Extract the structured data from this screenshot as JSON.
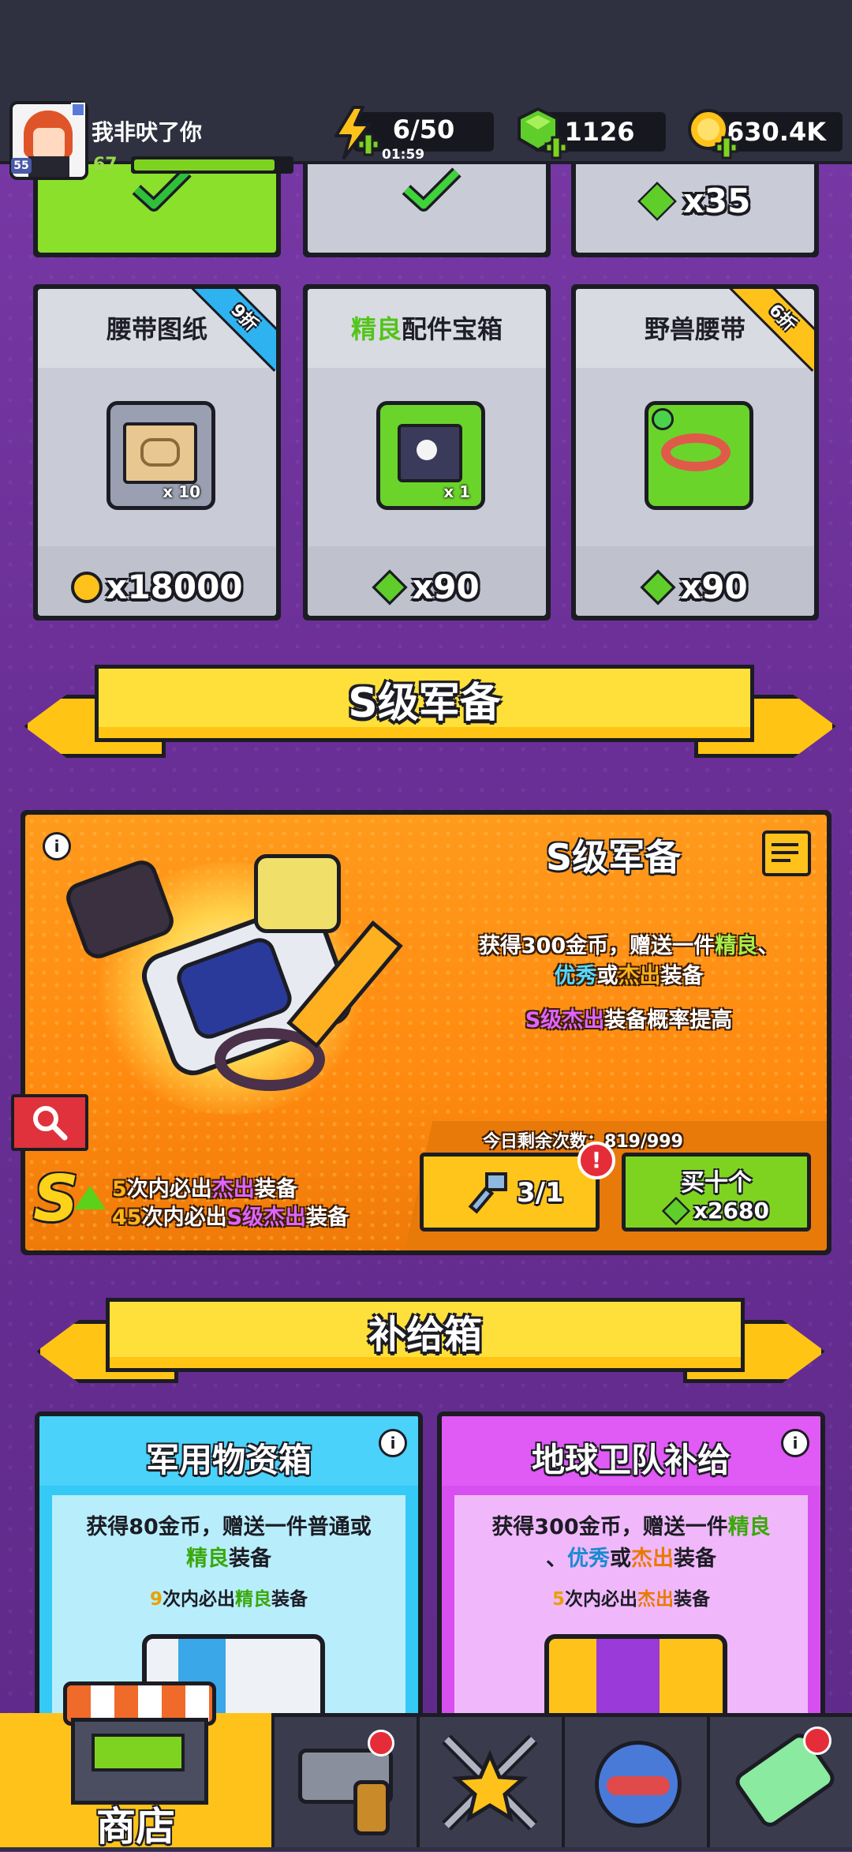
{
  "player": {
    "name": "我非吠了你",
    "level": "55",
    "xp_level": "67",
    "xp_progress": 0.9
  },
  "resources": {
    "energy": {
      "value": "6/50",
      "timer": "01:59"
    },
    "gems": {
      "value": "1126"
    },
    "coins": {
      "value": "630.4K"
    }
  },
  "top_row": {
    "gem_price": "x35"
  },
  "shop_cards": [
    {
      "title": "腰带图纸",
      "qty": "x 10",
      "price": "x18000",
      "currency": "coin-icon",
      "badge": "9折"
    },
    {
      "title_highlight": "精良",
      "title_rest": "配件宝箱",
      "qty": "x 1",
      "price": "x90",
      "currency": "gem-icon"
    },
    {
      "title": "野兽腰带",
      "price": "x90",
      "currency": "gem-icon",
      "badge": "6折"
    }
  ],
  "section_s": {
    "banner": "S级军备"
  },
  "s_panel": {
    "title": "S级军备",
    "desc_line1_a": "获得300金币，赠送一件",
    "desc_line1_g": "精良",
    "desc_line1_c": "、",
    "desc_line2_b": "优秀",
    "desc_line2_a": "或",
    "desc_line2_o": "杰出",
    "desc_line2_c": "装备",
    "desc_line3_p": "S级杰出",
    "desc_line3_a": "装备概率提高",
    "pity1_num": "5",
    "pity1_a": "次内必出",
    "pity1_o": "杰出",
    "pity1_c": "装备",
    "pity2_num": "45",
    "pity2_a": "次内必出",
    "pity2_p": "S级杰出",
    "pity2_c": "装备",
    "remaining": "今日剩余次数：819/999",
    "key_count": "3/1",
    "buy_ten": "买十个",
    "buy_ten_price": "x2680",
    "alert": "!"
  },
  "section_supply": {
    "banner": "补给箱"
  },
  "supply_boxes": [
    {
      "title": "军用物资箱",
      "line1": "获得80金币，赠送一件普通或",
      "line2_g": "精良",
      "line2_c": "装备",
      "pity_num": "9",
      "pity_a": "次内必出",
      "pity_g": "精良",
      "pity_c": "装备",
      "bg": "#35c9f5",
      "panel": "#b8eefc"
    },
    {
      "title": "地球卫队补给",
      "line1_a": "获得300金币，赠送一件",
      "line1_g": "精良",
      "line2_a": "、",
      "line2_b": "优秀",
      "line2_c": "或",
      "line2_o": "杰出",
      "line2_d": "装备",
      "pity_num": "5",
      "pity_a": "次内必出",
      "pity_o": "杰出",
      "pity_c": "装备",
      "bg": "#d84ff0",
      "panel": "#f0b8fb"
    }
  ],
  "nav": {
    "shop_label": "商店"
  },
  "colors": {
    "accent_gold": "#ffc414",
    "gem_green": "#7ed321",
    "dark": "#1c1c24"
  }
}
